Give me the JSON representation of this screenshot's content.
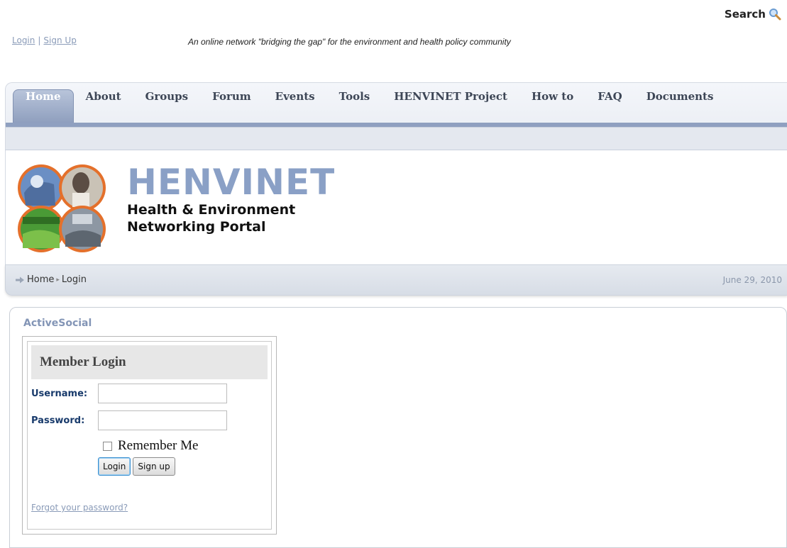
{
  "header_top": {
    "search_label": "Search",
    "login_link": "Login",
    "separator": "|",
    "signup_link": "Sign Up",
    "tagline": "An online network \"bridging the gap\" for the environment and health policy community"
  },
  "nav": {
    "tabs": [
      {
        "label": "Home",
        "active": true
      },
      {
        "label": "About"
      },
      {
        "label": "Groups"
      },
      {
        "label": "Forum"
      },
      {
        "label": "Events"
      },
      {
        "label": "Tools"
      },
      {
        "label": "HENVINET Project"
      },
      {
        "label": "How to"
      },
      {
        "label": "FAQ"
      },
      {
        "label": "Documents"
      }
    ]
  },
  "brand": {
    "name": "HENVINET",
    "subtitle_line1": "Health & Environment",
    "subtitle_line2": "Networking Portal"
  },
  "breadcrumb": {
    "items": [
      "Home",
      "Login"
    ],
    "date": "June 29, 2010"
  },
  "content": {
    "section_title": "ActiveSocial",
    "login": {
      "heading": "Member Login",
      "username_label": "Username:",
      "username_value": "",
      "password_label": "Password:",
      "password_value": "",
      "remember_label": "Remember Me",
      "login_button": "Login",
      "signup_button": "Sign up",
      "forgot_link": "Forgot your password?"
    }
  },
  "colors": {
    "accent": "#8aa0c6",
    "link": "#8a9bb8",
    "label": "#183a6b"
  }
}
